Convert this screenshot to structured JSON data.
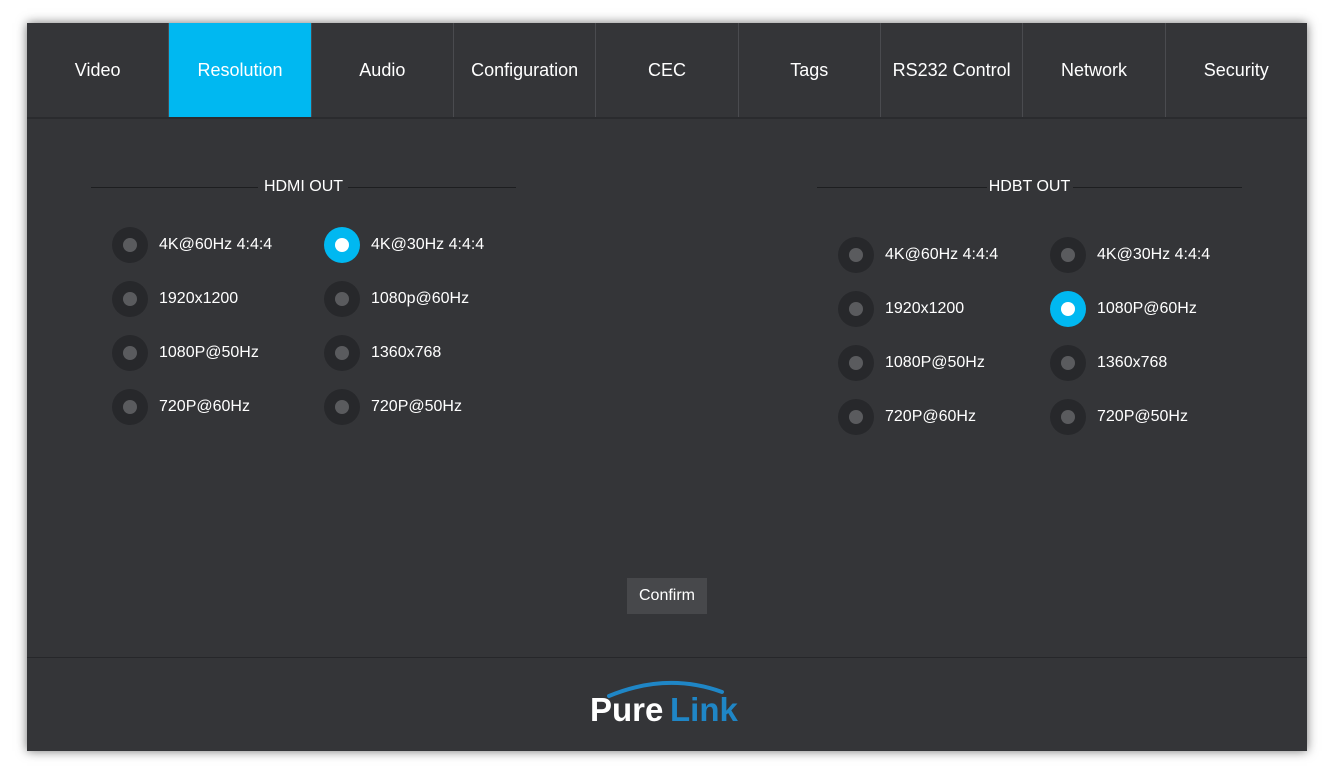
{
  "tabs": [
    {
      "label": "Video",
      "active": false
    },
    {
      "label": "Resolution",
      "active": true
    },
    {
      "label": "Audio",
      "active": false
    },
    {
      "label": "Configuration",
      "active": false
    },
    {
      "label": "CEC",
      "active": false
    },
    {
      "label": "Tags",
      "active": false
    },
    {
      "label": "RS232 Control",
      "active": false
    },
    {
      "label": "Network",
      "active": false
    },
    {
      "label": "Security",
      "active": false
    }
  ],
  "hdmi_out": {
    "title": "HDMI OUT",
    "selected": "4K@30Hz 4:4:4",
    "options": [
      "4K@60Hz 4:4:4",
      "4K@30Hz 4:4:4",
      "1920x1200",
      "1080p@60Hz",
      "1080P@50Hz",
      "1360x768",
      "720P@60Hz",
      "720P@50Hz"
    ]
  },
  "hdbt_out": {
    "title": "HDBT OUT",
    "selected": "1080P@60Hz",
    "options": [
      "4K@60Hz 4:4:4",
      "4K@30Hz 4:4:4",
      "1920x1200",
      "1080P@60Hz",
      "1080P@50Hz",
      "1360x768",
      "720P@60Hz",
      "720P@50Hz"
    ]
  },
  "confirm_label": "Confirm",
  "logo": {
    "part1": "Pure",
    "part2": "Link"
  },
  "colors": {
    "accent": "#00b8f1",
    "background": "#343538",
    "logo_blue": "#1f86c6"
  }
}
